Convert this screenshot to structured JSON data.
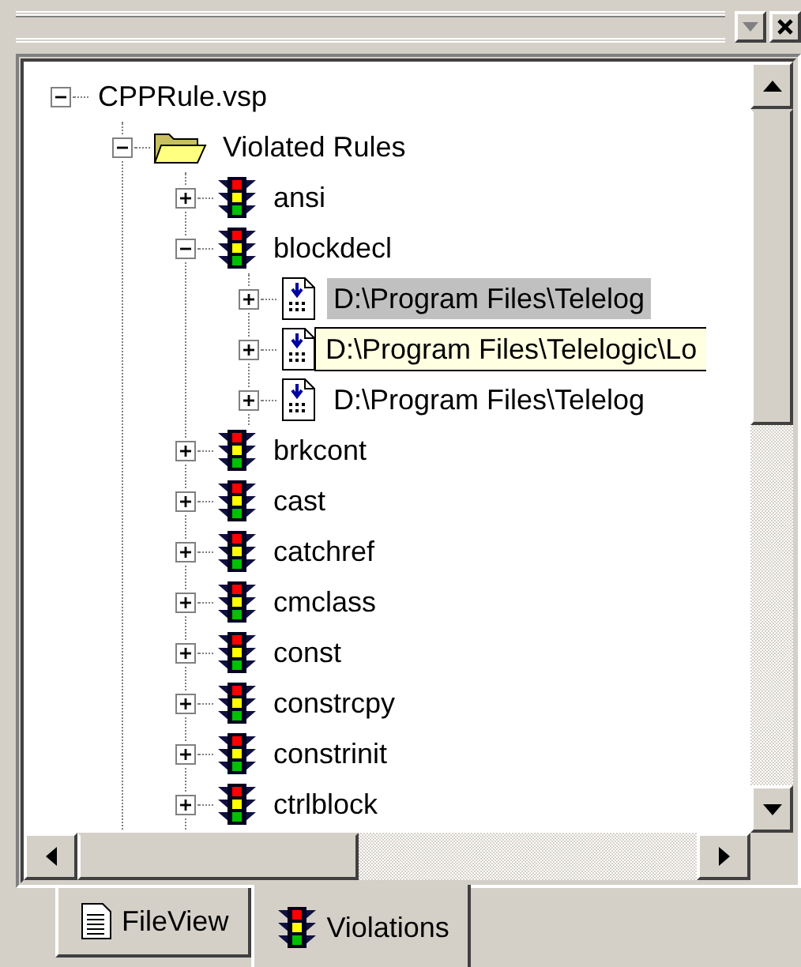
{
  "tree": [
    {
      "label": "CPPRule.vsp",
      "expanded": true,
      "selected": false,
      "children": [
        {
          "label": "Violated Rules",
          "kind": "folder",
          "expanded": true,
          "selected": false,
          "children": [
            {
              "label": "ansi",
              "kind": "rule",
              "expanded": false,
              "selected": false
            },
            {
              "label": "blockdecl",
              "kind": "rule",
              "expanded": true,
              "selected": false,
              "children": [
                {
                  "label": "D:\\Program Files\\Telelog",
                  "kind": "file",
                  "expanded": false,
                  "selected": true,
                  "tooltip": false
                },
                {
                  "label": "D:\\Program Files\\Telelogic\\Lo",
                  "kind": "file",
                  "expanded": false,
                  "selected": false,
                  "tooltip": true
                },
                {
                  "label": "D:\\Program Files\\Telelog",
                  "kind": "file",
                  "expanded": false,
                  "selected": false,
                  "tooltip": false
                }
              ]
            },
            {
              "label": "brkcont",
              "kind": "rule",
              "expanded": false,
              "selected": false
            },
            {
              "label": "cast",
              "kind": "rule",
              "expanded": false,
              "selected": false
            },
            {
              "label": "catchref",
              "kind": "rule",
              "expanded": false,
              "selected": false
            },
            {
              "label": "cmclass",
              "kind": "rule",
              "expanded": false,
              "selected": false
            },
            {
              "label": "const",
              "kind": "rule",
              "expanded": false,
              "selected": false
            },
            {
              "label": "constrcpy",
              "kind": "rule",
              "expanded": false,
              "selected": false
            },
            {
              "label": "constrinit",
              "kind": "rule",
              "expanded": false,
              "selected": false
            },
            {
              "label": "ctrlblock",
              "kind": "rule",
              "expanded": false,
              "selected": false
            }
          ]
        }
      ]
    }
  ],
  "tabs": [
    {
      "label": "FileView",
      "kind": "file",
      "selected": false
    },
    {
      "label": "Violations",
      "kind": "rule",
      "selected": true
    }
  ]
}
